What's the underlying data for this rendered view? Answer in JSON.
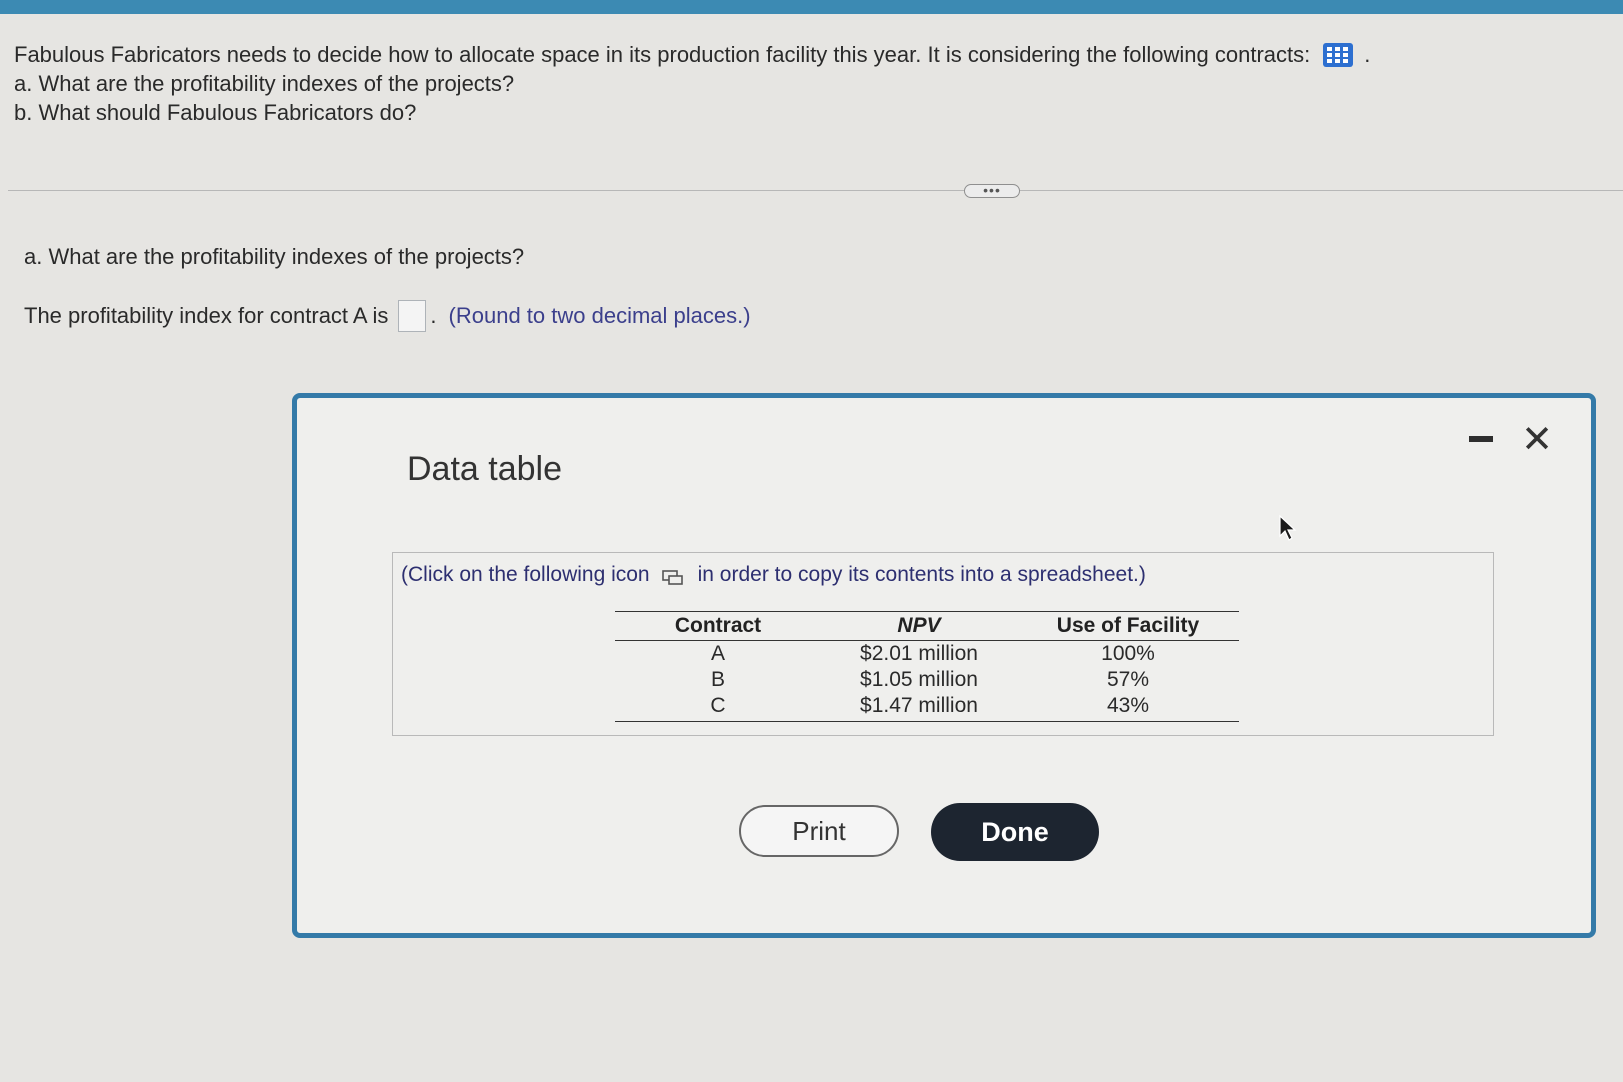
{
  "intro": {
    "line1": "Fabulous Fabricators needs to decide how to allocate space in its production facility this year. It is considering the following contracts:",
    "line1_end": ".",
    "q_a": "a. What are the profitability indexes of the projects?",
    "q_b": "b. What should Fabulous Fabricators do?"
  },
  "more_label": "•••",
  "question": {
    "label": "a. What are the profitability indexes of the projects?",
    "answer_prefix": "The profitability index for contract A is",
    "answer_value": "",
    "answer_suffix": ".",
    "note": "(Round to two decimal places.)"
  },
  "dialog": {
    "title": "Data table",
    "minimize_icon": "minimize-icon",
    "close_icon": "close-icon",
    "close_glyph": "✕",
    "copy_note_pre": "(Click on the following icon",
    "copy_note_post": "in order to copy its contents into a spreadsheet.)",
    "table": {
      "headers": [
        "Contract",
        "NPV",
        "Use of Facility"
      ],
      "rows": [
        [
          "A",
          "$2.01 million",
          "100%"
        ],
        [
          "B",
          "$1.05 million",
          "57%"
        ],
        [
          "C",
          "$1.47 million",
          "43%"
        ]
      ]
    },
    "print_label": "Print",
    "done_label": "Done"
  },
  "colors": {
    "accent": "#3c8ab3",
    "dialog_border": "#347aa8",
    "done_button": "#1d2530",
    "link_text": "#3b3f8c"
  }
}
